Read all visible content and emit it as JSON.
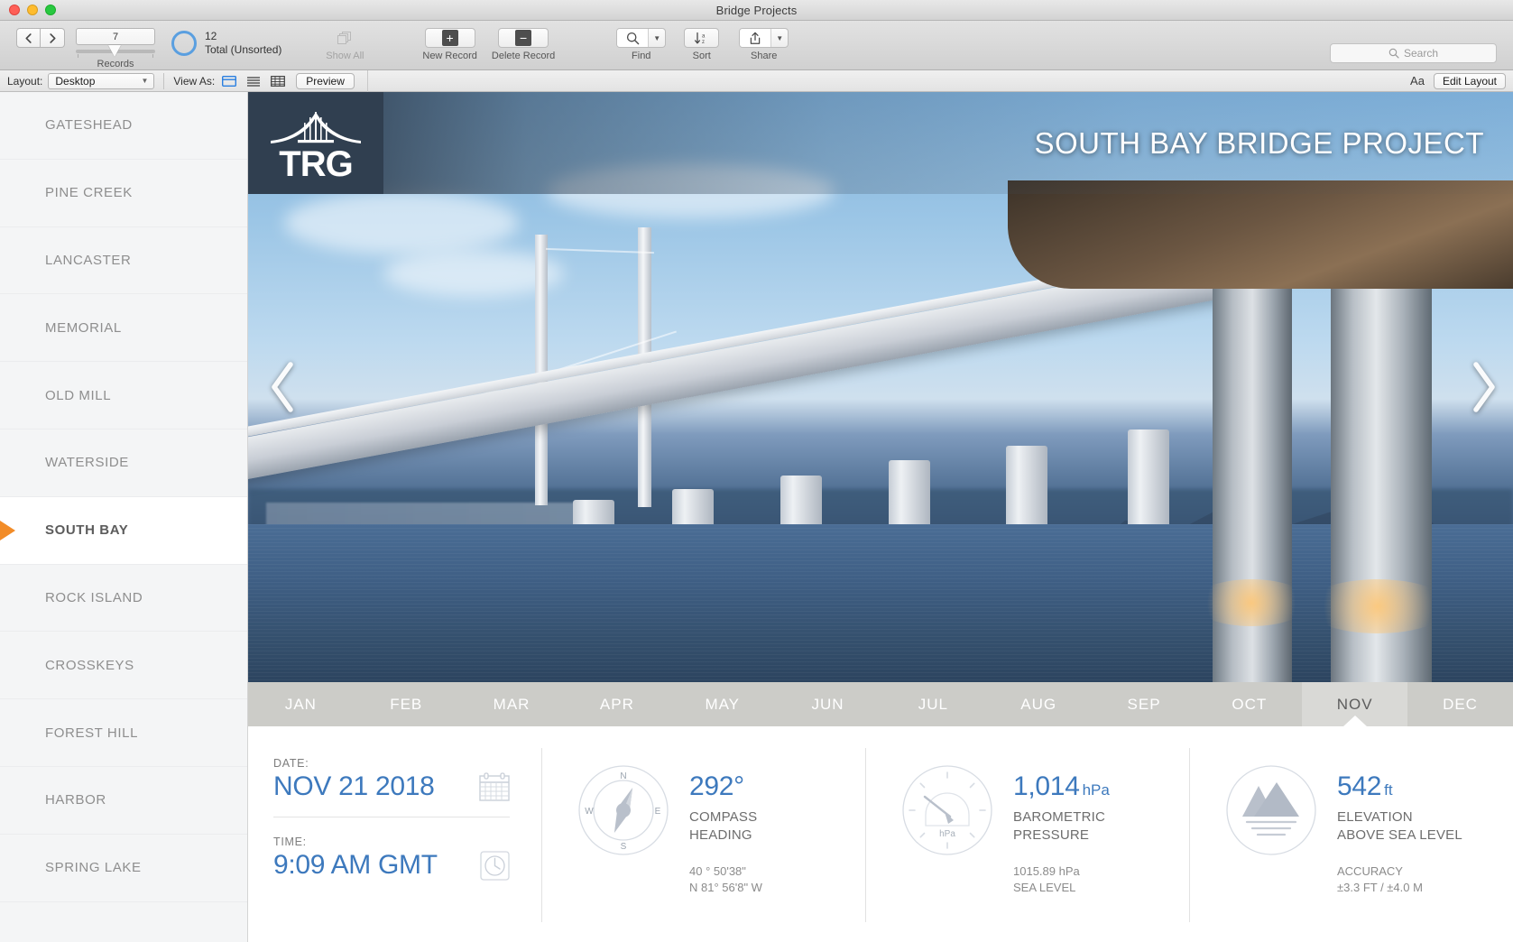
{
  "window": {
    "title": "Bridge Projects"
  },
  "toolbar": {
    "back_icon": "chevron-left-icon",
    "forward_icon": "chevron-right-icon",
    "record_index": "7",
    "records_label": "Records",
    "total_count": "12",
    "total_label": "Total (Unsorted)",
    "show_all_label": "Show All",
    "new_record_label": "New Record",
    "delete_record_label": "Delete Record",
    "find_label": "Find",
    "sort_label": "Sort",
    "share_label": "Share",
    "search_placeholder": "Search"
  },
  "layoutbar": {
    "layout_label": "Layout:",
    "layout_value": "Desktop",
    "view_as_label": "View As:",
    "preview_label": "Preview",
    "text_size_icon": "Aa",
    "edit_layout_label": "Edit Layout"
  },
  "sidebar": {
    "items": [
      {
        "label": "GATESHEAD",
        "active": false
      },
      {
        "label": "PINE CREEK",
        "active": false
      },
      {
        "label": "LANCASTER",
        "active": false
      },
      {
        "label": "MEMORIAL",
        "active": false
      },
      {
        "label": "OLD MILL",
        "active": false
      },
      {
        "label": "WATERSIDE",
        "active": false
      },
      {
        "label": "SOUTH BAY",
        "active": true
      },
      {
        "label": "ROCK ISLAND",
        "active": false
      },
      {
        "label": "CROSSKEYS",
        "active": false
      },
      {
        "label": "FOREST HILL",
        "active": false
      },
      {
        "label": "HARBOR",
        "active": false
      },
      {
        "label": "SPRING LAKE",
        "active": false
      }
    ]
  },
  "hero": {
    "logo_text": "TRG",
    "title": "SOUTH BAY BRIDGE PROJECT",
    "prev_icon": "chevron-left-icon",
    "next_icon": "chevron-right-icon"
  },
  "months": {
    "tabs": [
      {
        "label": "JAN",
        "active": false
      },
      {
        "label": "FEB",
        "active": false
      },
      {
        "label": "MAR",
        "active": false
      },
      {
        "label": "APR",
        "active": false
      },
      {
        "label": "MAY",
        "active": false
      },
      {
        "label": "JUN",
        "active": false
      },
      {
        "label": "JUL",
        "active": false
      },
      {
        "label": "AUG",
        "active": false
      },
      {
        "label": "SEP",
        "active": false
      },
      {
        "label": "OCT",
        "active": false
      },
      {
        "label": "NOV",
        "active": true
      },
      {
        "label": "DEC",
        "active": false
      }
    ]
  },
  "panel": {
    "date": {
      "label": "DATE:",
      "value": "NOV 21 2018",
      "icon": "calendar-icon"
    },
    "time": {
      "label": "TIME:",
      "value": "9:09 AM GMT",
      "icon": "clock-icon"
    },
    "compass": {
      "icon": "compass-icon",
      "value": "292°",
      "name_line1": "COMPASS",
      "name_line2": "HEADING",
      "sub_line1": "40 ° 50'38\"",
      "sub_line2": "N 81° 56'8\" W",
      "compass_n": "N",
      "compass_e": "E",
      "compass_s": "S",
      "compass_w": "W"
    },
    "pressure": {
      "icon": "gauge-icon",
      "value": "1,014",
      "unit": "hPa",
      "gauge_caption": "hPa",
      "name_line1": "BAROMETRIC",
      "name_line2": "PRESSURE",
      "sub_line1": "1015.89 hPa",
      "sub_line2": "SEA LEVEL"
    },
    "elevation": {
      "icon": "mountain-icon",
      "value": "542",
      "unit": "ft",
      "name_line1": "ELEVATION",
      "name_line2": "ABOVE SEA LEVEL",
      "sub_line1": "ACCURACY",
      "sub_line2": "±3.3 FT / ±4.0 M"
    }
  },
  "colors": {
    "accent_blue": "#3d79bd",
    "brand_navy": "#303f50",
    "selection_orange": "#f28c28",
    "month_bar": "#ccccc8"
  }
}
